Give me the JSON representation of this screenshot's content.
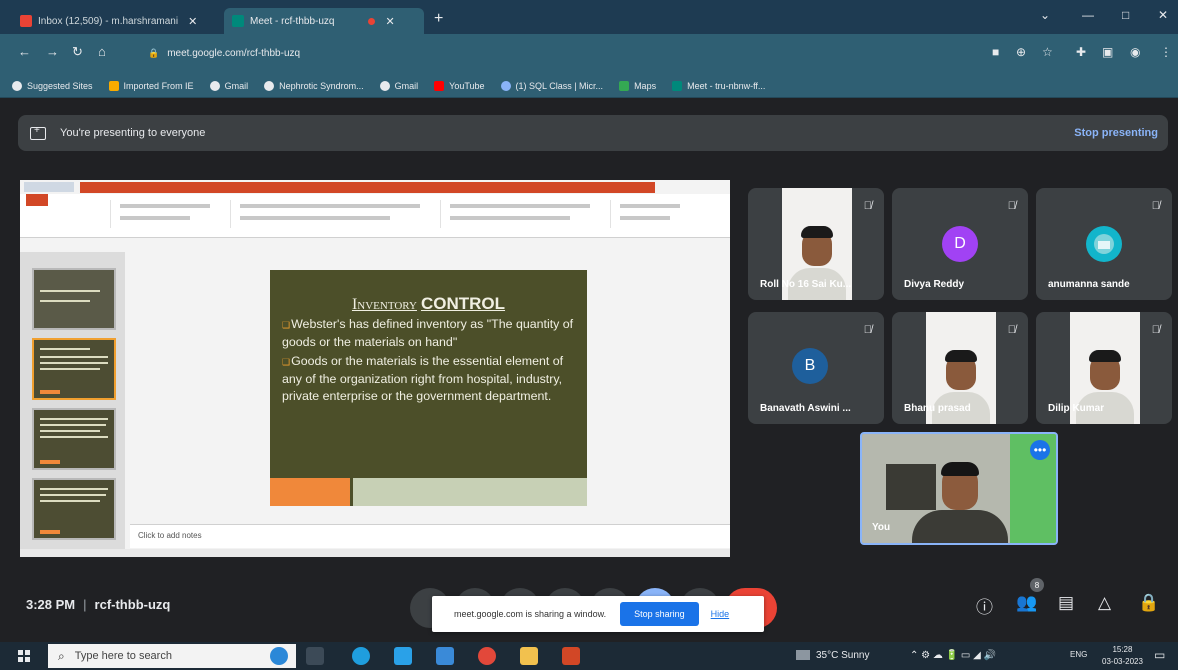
{
  "browser": {
    "tabs": [
      {
        "label": "Inbox (12,509) - m.harshramani",
        "close": "✕"
      },
      {
        "label": "Meet - rcf-thbb-uzq",
        "close": "✕"
      }
    ],
    "new_tab": "+",
    "url": "meet.google.com/rcf-thbb-uzq",
    "bookmarks": [
      "Suggested Sites",
      "Imported From IE",
      "Gmail",
      "Nephrotic Syndrom...",
      "Gmail",
      "YouTube",
      "(1) SQL Class | Micr...",
      "Maps",
      "Meet - tru-nbnw-ff..."
    ]
  },
  "banner": {
    "text": "You're presenting to everyone",
    "stop_label": "Stop presenting"
  },
  "slide": {
    "title_part1": "Inventory",
    "title_part2": "CONTROL",
    "bullets": [
      "Webster's has defined inventory as \"The quantity of goods or the materials on hand\"",
      "Goods or the materials is the essential element of any of the organization right from hospital, industry, private enterprise or the government department."
    ],
    "notes_placeholder": "Click to add notes"
  },
  "participants": [
    {
      "name": "Roll No 16 Sai Ku...",
      "type": "video"
    },
    {
      "name": "Divya Reddy",
      "type": "avatar",
      "initial": "D",
      "color": "#a142f4"
    },
    {
      "name": "anumanna sande",
      "type": "avatar",
      "initial": "",
      "color": "#12b5cb"
    },
    {
      "name": "Banavath Aswini ...",
      "type": "avatar",
      "initial": "B",
      "color": "#1e5f9c"
    },
    {
      "name": "Bhanu prasad",
      "type": "video"
    },
    {
      "name": "Dilip Kumar",
      "type": "video"
    }
  ],
  "self_view": {
    "name": "You",
    "more": "•••"
  },
  "meeting": {
    "time": "3:28 PM",
    "code": "rcf-thbb-uzq",
    "participant_badge": "8"
  },
  "sharing_bar": {
    "text": "meet.google.com is sharing a window.",
    "stop_label": "Stop sharing",
    "hide_label": "Hide"
  },
  "taskbar": {
    "search_placeholder": "Type here to search",
    "weather": "35°C Sunny",
    "language": "ENG",
    "time": "15:28",
    "date": "03-03-2023"
  }
}
